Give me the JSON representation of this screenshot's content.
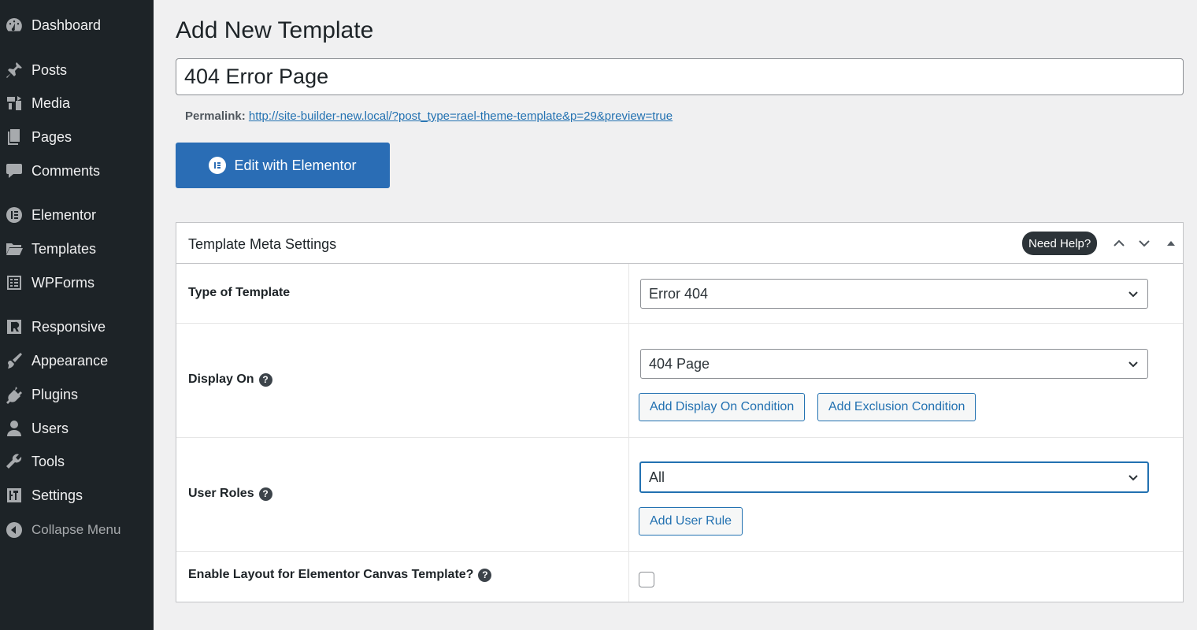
{
  "sidebar": {
    "items": [
      {
        "label": "Dashboard",
        "icon": "dashboard-icon"
      },
      {
        "label": "Posts",
        "icon": "pin-icon"
      },
      {
        "label": "Media",
        "icon": "media-icon"
      },
      {
        "label": "Pages",
        "icon": "pages-icon"
      },
      {
        "label": "Comments",
        "icon": "comment-icon"
      },
      {
        "label": "Elementor",
        "icon": "elementor-icon"
      },
      {
        "label": "Templates",
        "icon": "folder-icon"
      },
      {
        "label": "WPForms",
        "icon": "wpforms-icon"
      },
      {
        "label": "Responsive",
        "icon": "responsive-icon"
      },
      {
        "label": "Appearance",
        "icon": "brush-icon"
      },
      {
        "label": "Plugins",
        "icon": "plugin-icon"
      },
      {
        "label": "Users",
        "icon": "user-icon"
      },
      {
        "label": "Tools",
        "icon": "wrench-icon"
      },
      {
        "label": "Settings",
        "icon": "settings-icon"
      }
    ],
    "collapse_label": "Collapse Menu"
  },
  "page": {
    "title": "Add New Template",
    "post_title": "404 Error Page",
    "permalink_label": "Permalink:",
    "permalink_url": "http://site-builder-new.local/?post_type=rael-theme-template&p=29&preview=true",
    "edit_button": "Edit with Elementor"
  },
  "metabox": {
    "title": "Template Meta Settings",
    "help_label": "Need Help?",
    "rows": {
      "type": {
        "label": "Type of Template",
        "value": "Error 404"
      },
      "display_on": {
        "label": "Display On",
        "value": "404 Page",
        "btn_add": "Add Display On Condition",
        "btn_exclude": "Add Exclusion Condition"
      },
      "user_roles": {
        "label": "User Roles",
        "value": "All",
        "btn_add": "Add User Rule"
      },
      "canvas": {
        "label": "Enable Layout for Elementor Canvas Template?",
        "checked": false
      }
    }
  },
  "colors": {
    "sidebar_bg": "#1d2327",
    "accent": "#2271b1",
    "elementor_button": "#2a6db5",
    "page_bg": "#f0f0f1"
  }
}
